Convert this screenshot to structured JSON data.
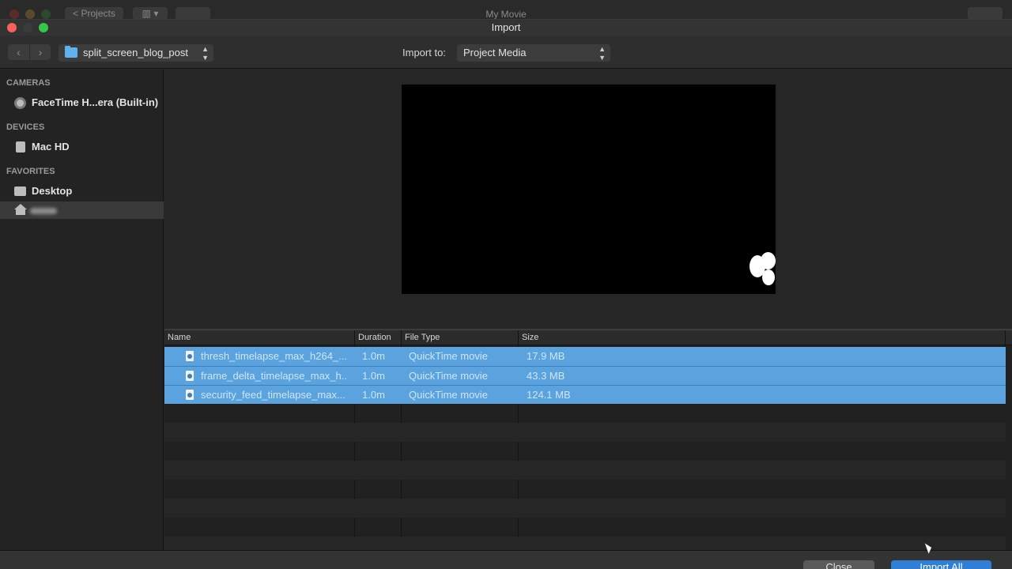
{
  "background_app": {
    "back_button_label": "< Projects",
    "view_button_label": "▥ ▾",
    "title": "My Movie"
  },
  "window": {
    "title": "Import"
  },
  "toolbar": {
    "location": "split_screen_blog_post",
    "import_to_label": "Import to:",
    "import_to_value": "Project Media"
  },
  "sidebar": {
    "sections": [
      {
        "title": "CAMERAS",
        "items": [
          {
            "label": "FaceTime H...era (Built-in)",
            "icon": "camera-icon"
          }
        ]
      },
      {
        "title": "DEVICES",
        "items": [
          {
            "label": "Mac HD",
            "icon": "hard-drive-icon"
          }
        ]
      },
      {
        "title": "FAVORITES",
        "items": [
          {
            "label": "Desktop",
            "icon": "desktop-icon"
          },
          {
            "label": "",
            "icon": "home-icon"
          }
        ]
      }
    ]
  },
  "table": {
    "columns": [
      "Name",
      "Duration",
      "File Type",
      "Size"
    ],
    "rows": [
      {
        "name": "thresh_timelapse_max_h264_...",
        "duration": "1.0m",
        "type": "QuickTime movie",
        "size": "17.9 MB"
      },
      {
        "name": "frame_delta_timelapse_max_h...",
        "duration": "1.0m",
        "type": "QuickTime movie",
        "size": "43.3 MB"
      },
      {
        "name": "security_feed_timelapse_max...",
        "duration": "1.0m",
        "type": "QuickTime movie",
        "size": "124.1 MB"
      }
    ]
  },
  "footer": {
    "close_label": "Close",
    "import_label": "Import All"
  },
  "colors": {
    "selection": "#5aa3de",
    "primary_button": "#2f7fd6",
    "folder": "#5fb2ee"
  }
}
